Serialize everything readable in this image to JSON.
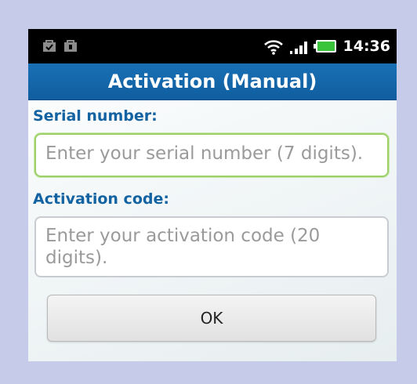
{
  "status_bar": {
    "left_icons": [
      "bag-icon",
      "bag-icon"
    ],
    "right_icons": [
      "wifi-icon",
      "signal-icon",
      "battery-icon"
    ],
    "time": "14:36"
  },
  "header": {
    "title": "Activation (Manual)"
  },
  "form": {
    "serial": {
      "label": "Serial number:",
      "placeholder": "Enter your serial number (7 digits).",
      "value": ""
    },
    "activation": {
      "label": "Activation code:",
      "placeholder": "Enter your activation code (20 digits).",
      "value": ""
    },
    "ok_label": "OK"
  },
  "colors": {
    "title_bar": "#1567ab",
    "label": "#1363a2",
    "focus_border": "#9ed06a"
  }
}
